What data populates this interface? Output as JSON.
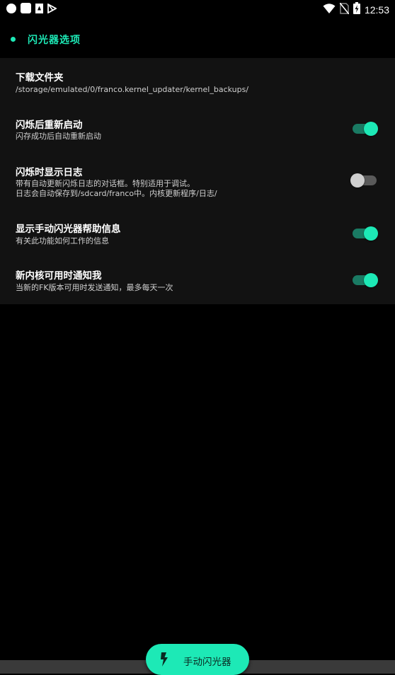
{
  "status_bar": {
    "time": "12:53",
    "left_icons": [
      "notification-circle-icon",
      "notification-square-icon",
      "document-icon",
      "play-store-icon"
    ],
    "right_icons": [
      "wifi-icon",
      "no-sim-icon",
      "battery-charging-icon"
    ]
  },
  "section": {
    "title": "闪光器选项"
  },
  "settings": [
    {
      "title": "下载文件夹",
      "subtitle_lines": [
        "/storage/emulated/0/franco.kernel_updater/kernel_backups/"
      ],
      "has_switch": false
    },
    {
      "title": "闪烁后重新启动",
      "subtitle_lines": [
        "闪存成功后自动重新启动"
      ],
      "has_switch": true,
      "enabled": true
    },
    {
      "title": "闪烁时显示日志",
      "subtitle_lines": [
        "带有自动更新闪烁日志的对话框。特别适用于调试。",
        "日志会自动保存到/sdcard/franco中。内核更新程序/日志/"
      ],
      "has_switch": true,
      "enabled": false
    },
    {
      "title": "显示手动闪光器帮助信息",
      "subtitle_lines": [
        "有关此功能如何工作的信息"
      ],
      "has_switch": true,
      "enabled": true
    },
    {
      "title": "新内核可用时通知我",
      "subtitle_lines": [
        "当新的FK版本可用时发送通知，最多每天一次"
      ],
      "has_switch": true,
      "enabled": true
    }
  ],
  "fab": {
    "label": "手动闪光器",
    "icon": "flash-icon"
  },
  "colors": {
    "accent": "#1de9b6",
    "card_bg": "#121212",
    "background": "#000000"
  }
}
